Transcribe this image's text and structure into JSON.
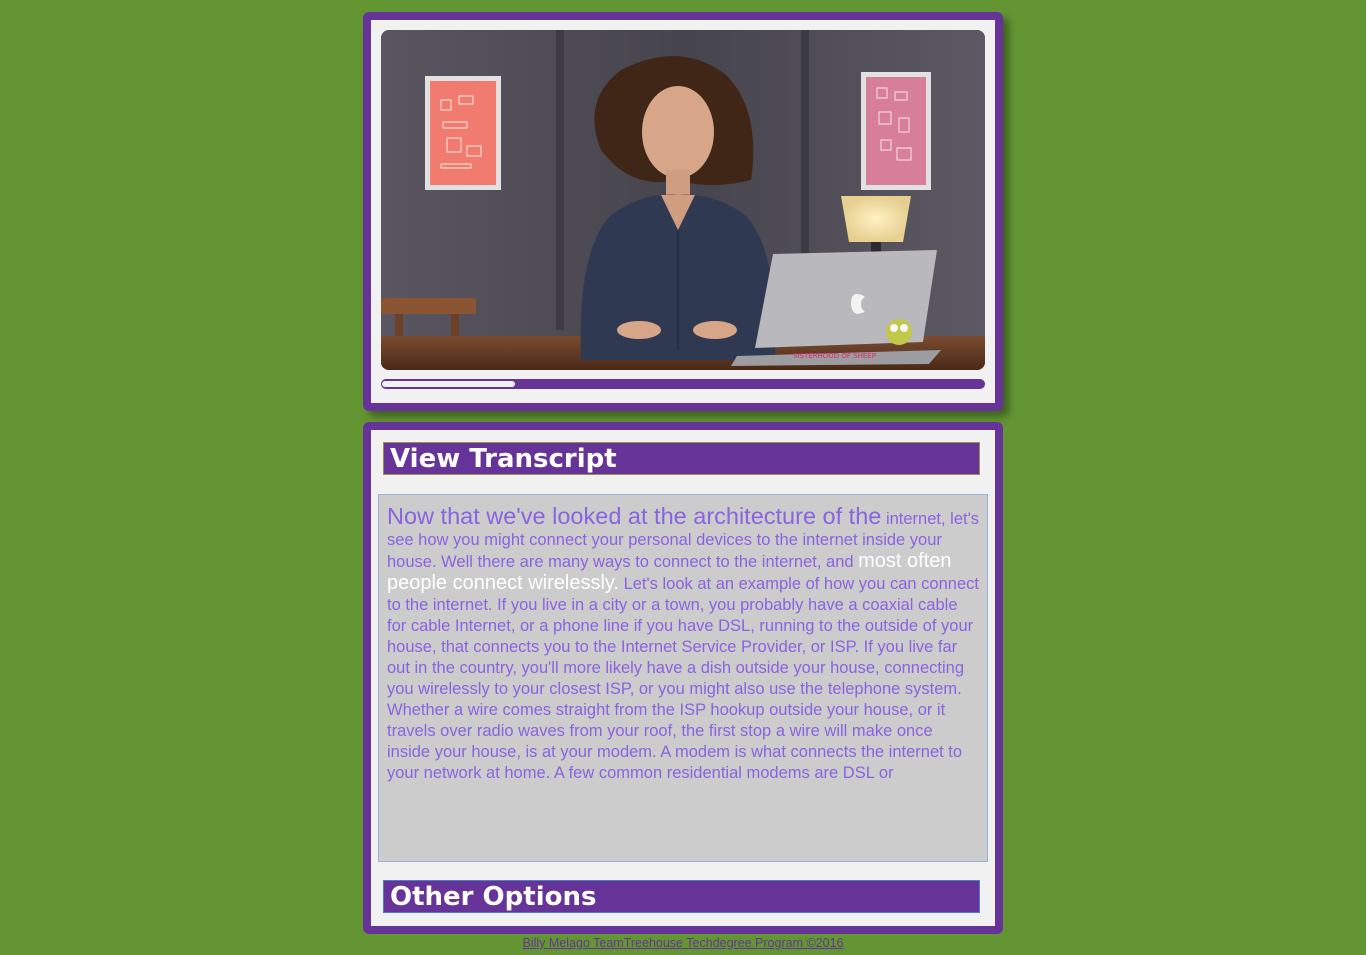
{
  "video": {
    "progress_fraction": 0.22,
    "sticker_text": "SISTERHOOD OF SHEEP"
  },
  "transcript": {
    "header": "View Transcript",
    "lead": "Now that we've looked at the architecture of the",
    "before_highlight": "internet, let's see how you might connect your personal devices to the internet inside your house. Well there are many ways to connect to the internet, and",
    "highlight": "most often people connect wirelessly.",
    "after_highlight": "Let's look at an example of how you can connect to the internet. If you live in a city or a town, you probably have a coaxial cable for cable Internet, or a phone line if you have DSL, running to the outside of your house, that connects you to the Internet Service Provider, or ISP. If you live far out in the country, you'll more likely have a dish outside your house, connecting you wirelessly to your closest ISP, or you might also use the telephone system. Whether a wire comes straight from the ISP hookup outside your house, or it travels over radio waves from your roof, the first stop a wire will make once inside your house, is at your modem. A modem is what connects the internet to your network at home. A few common residential modems are DSL or"
  },
  "options": {
    "header": "Other Options"
  },
  "footer": {
    "text": "Billy Melago TeamTreehouse Techdegree Program ©2016"
  },
  "colors": {
    "background": "#639633",
    "accent": "#663399",
    "card": "#f1f1f1",
    "transcript_text": "#8a63e0",
    "transcript_highlight": "#ffffff"
  }
}
